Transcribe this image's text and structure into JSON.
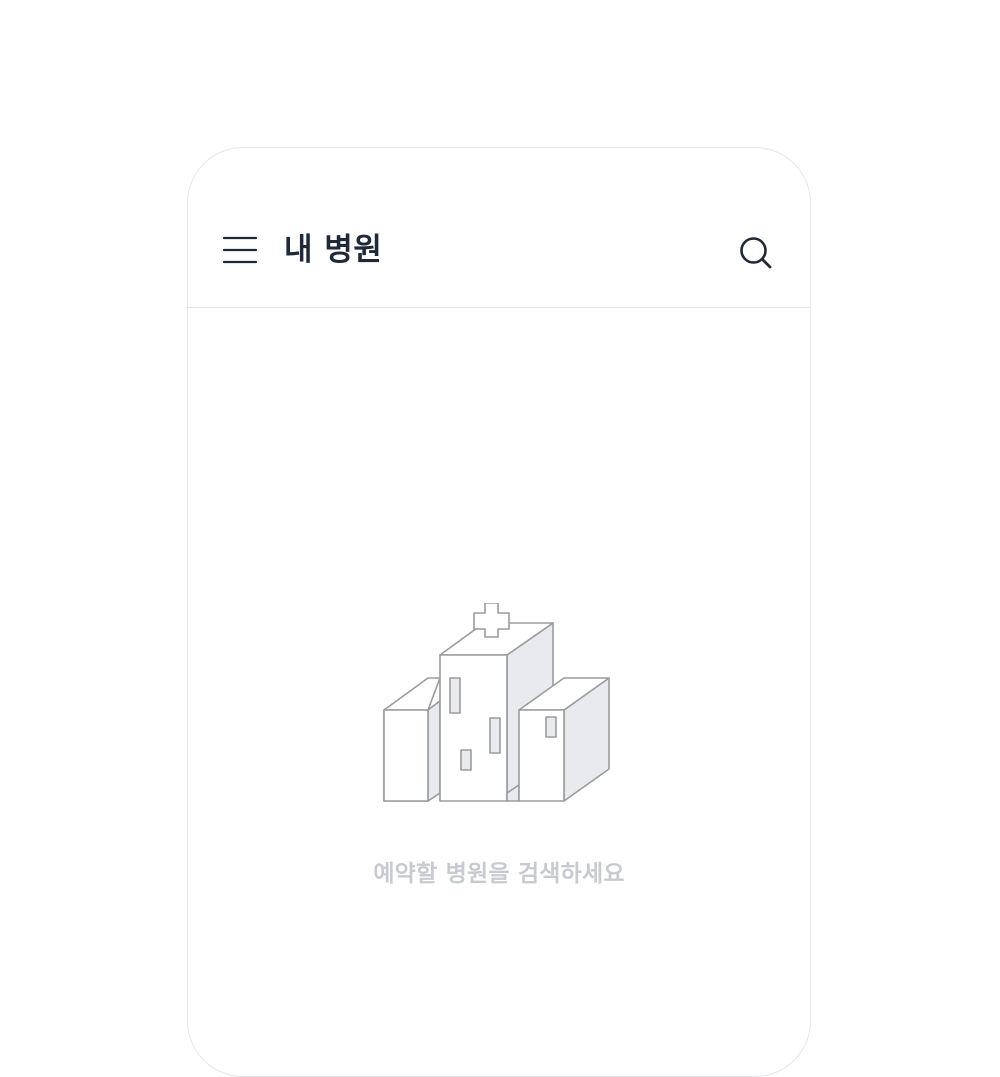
{
  "header": {
    "title": "내 병원",
    "menu_icon": "hamburger-menu-icon",
    "search_icon": "search-icon"
  },
  "empty_state": {
    "illustration_icon": "hospital-illustration-icon",
    "message": "예약할 병원을 검색하세요"
  },
  "colors": {
    "title": "#1f2937",
    "icon_stroke": "#1f2937",
    "divider": "#e3e5e8",
    "illustration_stroke": "#9a9ba0",
    "illustration_fill": "#e8eaee",
    "empty_message": "#c7cbd1"
  }
}
